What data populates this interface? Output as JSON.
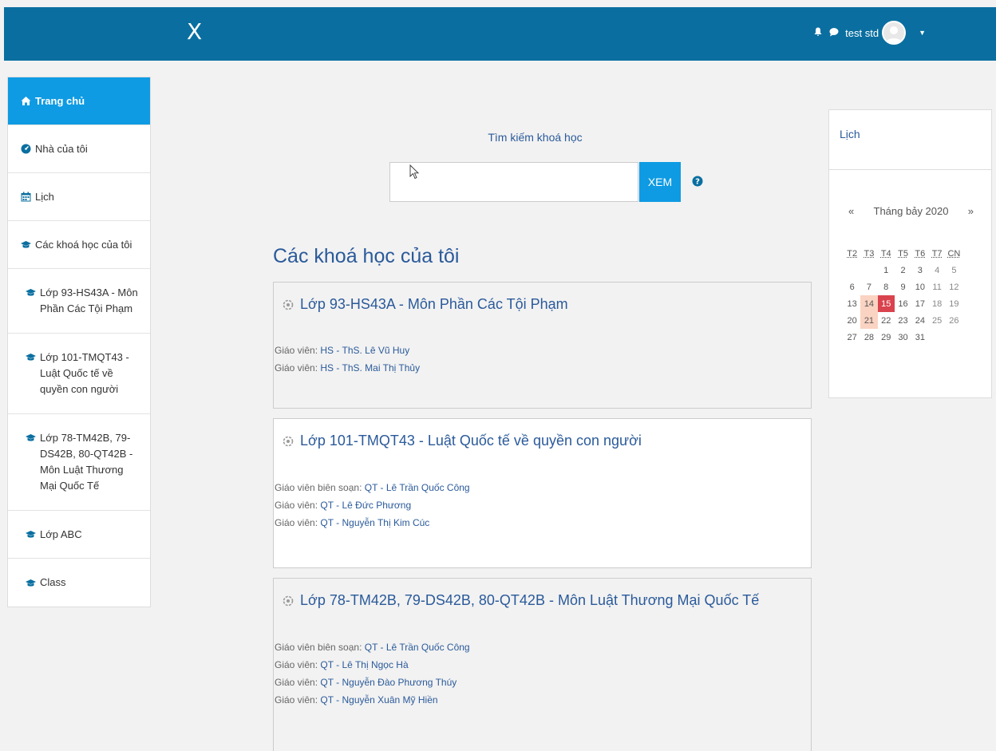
{
  "header": {
    "logo": "X",
    "username": "test std"
  },
  "sidebar": {
    "items": [
      {
        "label": "Trang chủ",
        "icon": "home-icon",
        "active": true
      },
      {
        "label": "Nhà của tôi",
        "icon": "dashboard-icon"
      },
      {
        "label": "Lịch",
        "icon": "calendar-icon"
      },
      {
        "label": "Các khoá học của tôi",
        "icon": "graduation-cap-icon"
      },
      {
        "label": "Lớp 93-HS43A - Môn Phần Các Tội Phạm",
        "icon": "graduation-cap-icon"
      },
      {
        "label": "Lớp 101-TMQT43 - Luật Quốc tế về quyền con người",
        "icon": "graduation-cap-icon"
      },
      {
        "label": "Lớp 78-TM42B, 79-DS42B, 80-QT42B - Môn Luật Thương Mại Quốc Tế",
        "icon": "graduation-cap-icon"
      },
      {
        "label": "Lớp ABC",
        "icon": "graduation-cap-icon"
      },
      {
        "label": "Class",
        "icon": "graduation-cap-icon"
      }
    ]
  },
  "search": {
    "label": "Tìm kiếm khoá học",
    "value": "",
    "button": "XEM"
  },
  "main": {
    "section_title": "Các khoá học của tôi",
    "courses": [
      {
        "title": "Lớp 93-HS43A - Môn Phần Các Tội Phạm",
        "teachers": [
          {
            "role": "Giáo viên:",
            "name": "HS - ThS. Lê Vũ Huy"
          },
          {
            "role": "Giáo viên:",
            "name": "HS - ThS. Mai Thị Thủy"
          }
        ]
      },
      {
        "title": "Lớp 101-TMQT43 - Luật Quốc tế về quyền con người",
        "teachers": [
          {
            "role": "Giáo viên biên soạn:",
            "name": "QT - Lê Trần Quốc Công"
          },
          {
            "role": "Giáo viên:",
            "name": "QT - Lê Đức Phương"
          },
          {
            "role": "Giáo viên:",
            "name": "QT - Nguyễn Thị Kim Cúc"
          }
        ]
      },
      {
        "title": "Lớp 78-TM42B, 79-DS42B, 80-QT42B - Môn Luật Thương Mại Quốc Tế",
        "teachers": [
          {
            "role": "Giáo viên biên soạn:",
            "name": "QT - Lê Trần Quốc Công"
          },
          {
            "role": "Giáo viên:",
            "name": "QT - Lê Thị Ngọc Hà"
          },
          {
            "role": "Giáo viên:",
            "name": "QT - Nguyễn Đào Phương Thúy"
          },
          {
            "role": "Giáo viên:",
            "name": "QT - Nguyễn Xuân Mỹ Hiền"
          }
        ]
      }
    ]
  },
  "calendar": {
    "title": "Lịch",
    "prev": "«",
    "next": "»",
    "month": "Tháng bảy 2020",
    "weekdays": [
      "T2",
      "T3",
      "T4",
      "T5",
      "T6",
      "T7",
      "CN"
    ],
    "weeks": [
      [
        "",
        "",
        "1",
        "2",
        "3",
        "4",
        "5"
      ],
      [
        "6",
        "7",
        "8",
        "9",
        "10",
        "11",
        "12"
      ],
      [
        "13",
        "14",
        "15",
        "16",
        "17",
        "18",
        "19"
      ],
      [
        "20",
        "21",
        "22",
        "23",
        "24",
        "25",
        "26"
      ],
      [
        "27",
        "28",
        "29",
        "30",
        "31",
        "",
        ""
      ]
    ],
    "today": "15",
    "highlighted": [
      "14",
      "21"
    ],
    "today_color": "#d9434e",
    "highlight_color": "#fbd3c2"
  },
  "colors": {
    "navbar": "#0a6fa0",
    "accent": "#0e9be3",
    "link": "#2a5a9a"
  }
}
